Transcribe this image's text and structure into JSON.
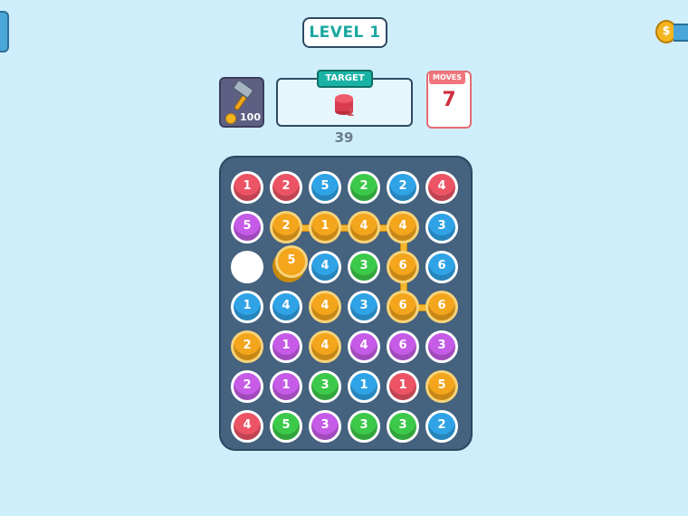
{
  "header": {
    "level": "LEVEL 1"
  },
  "edge_coin_label": "$",
  "hammer": {
    "cost": "100",
    "icon": "hammer-icon"
  },
  "target": {
    "label": "TARGET",
    "chip_color": "#ec5466",
    "count": "1"
  },
  "moves": {
    "label": "MOVES",
    "value": "7"
  },
  "score": "39",
  "colors": {
    "red": "#ec5466",
    "blue": "#2fa3e6",
    "green": "#3cc94a",
    "purple": "#c55be6",
    "orange": "#f3a51c"
  },
  "board": {
    "rows": [
      [
        {
          "c": "red",
          "n": "1"
        },
        {
          "c": "red",
          "n": "2"
        },
        {
          "c": "blue",
          "n": "5"
        },
        {
          "c": "green",
          "n": "2"
        },
        {
          "c": "blue",
          "n": "2"
        },
        {
          "c": "red",
          "n": "4"
        }
      ],
      [
        {
          "c": "purple",
          "n": "5"
        },
        {
          "c": "orange",
          "n": "2"
        },
        {
          "c": "orange",
          "n": "1"
        },
        {
          "c": "orange",
          "n": "4"
        },
        {
          "c": "orange",
          "n": "4"
        },
        {
          "c": "blue",
          "n": "3"
        }
      ],
      [
        {
          "c": "empty",
          "n": ""
        },
        {
          "c": "orange",
          "n": "5",
          "lifted": true
        },
        {
          "c": "blue",
          "n": "4"
        },
        {
          "c": "green",
          "n": "3"
        },
        {
          "c": "orange",
          "n": "6"
        },
        {
          "c": "blue",
          "n": "6"
        }
      ],
      [
        {
          "c": "blue",
          "n": "1"
        },
        {
          "c": "blue",
          "n": "4"
        },
        {
          "c": "orange",
          "n": "4"
        },
        {
          "c": "blue",
          "n": "3"
        },
        {
          "c": "orange",
          "n": "6"
        },
        {
          "c": "orange",
          "n": "6"
        }
      ],
      [
        {
          "c": "orange",
          "n": "2"
        },
        {
          "c": "purple",
          "n": "1"
        },
        {
          "c": "orange",
          "n": "4"
        },
        {
          "c": "purple",
          "n": "4"
        },
        {
          "c": "purple",
          "n": "6"
        },
        {
          "c": "purple",
          "n": "3"
        }
      ],
      [
        {
          "c": "purple",
          "n": "2"
        },
        {
          "c": "purple",
          "n": "1"
        },
        {
          "c": "green",
          "n": "3"
        },
        {
          "c": "blue",
          "n": "1"
        },
        {
          "c": "red",
          "n": "1"
        },
        {
          "c": "orange",
          "n": "5"
        }
      ],
      [
        {
          "c": "red",
          "n": "4"
        },
        {
          "c": "green",
          "n": "5"
        },
        {
          "c": "purple",
          "n": "3"
        },
        {
          "c": "green",
          "n": "3"
        },
        {
          "c": "green",
          "n": "3"
        },
        {
          "c": "blue",
          "n": "2"
        }
      ]
    ],
    "links": [
      [
        [
          1,
          1
        ],
        [
          1,
          2
        ]
      ],
      [
        [
          1,
          2
        ],
        [
          1,
          3
        ]
      ],
      [
        [
          1,
          3
        ],
        [
          1,
          4
        ]
      ],
      [
        [
          1,
          4
        ],
        [
          2,
          4
        ]
      ],
      [
        [
          2,
          4
        ],
        [
          3,
          4
        ]
      ],
      [
        [
          3,
          4
        ],
        [
          3,
          5
        ]
      ]
    ]
  }
}
